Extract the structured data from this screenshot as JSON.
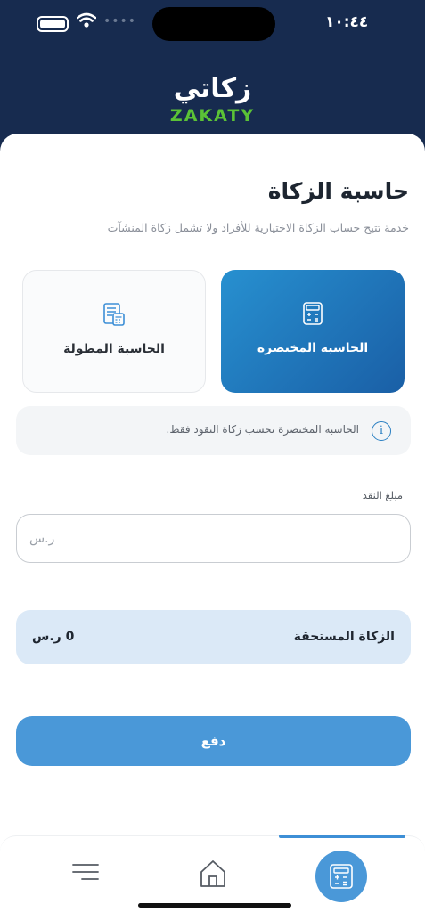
{
  "status": {
    "time": "١٠:٤٤"
  },
  "header": {
    "logo_ar": "زكاتي",
    "logo_en": "ZAKATY"
  },
  "page": {
    "title": "حاسبة الزكاة",
    "subtitle": "خدمة تتيح حساب الزكاة الاختيارية للأفراد ولا تشمل زكاة المنشآت"
  },
  "options": [
    {
      "label": "الحاسبة المختصرة",
      "selected": true
    },
    {
      "label": "الحاسبة المطولة",
      "selected": false
    }
  ],
  "info": {
    "text": "الحاسبة المختصرة تحسب زكاة النقود فقط."
  },
  "cash_field": {
    "label": "مبلغ النقد",
    "placeholder": "ر.س",
    "value": ""
  },
  "result": {
    "label": "الزكاة المستحقة",
    "value": "0 ر.س"
  },
  "pay": {
    "label": "دفع"
  },
  "tabbar": {
    "items": [
      "menu-icon",
      "home-icon",
      "calculator-icon"
    ],
    "active": "calculator-icon"
  },
  "colors": {
    "header": "#172b4f",
    "accent": "#4a98d8",
    "brand_green": "#5bc236"
  }
}
